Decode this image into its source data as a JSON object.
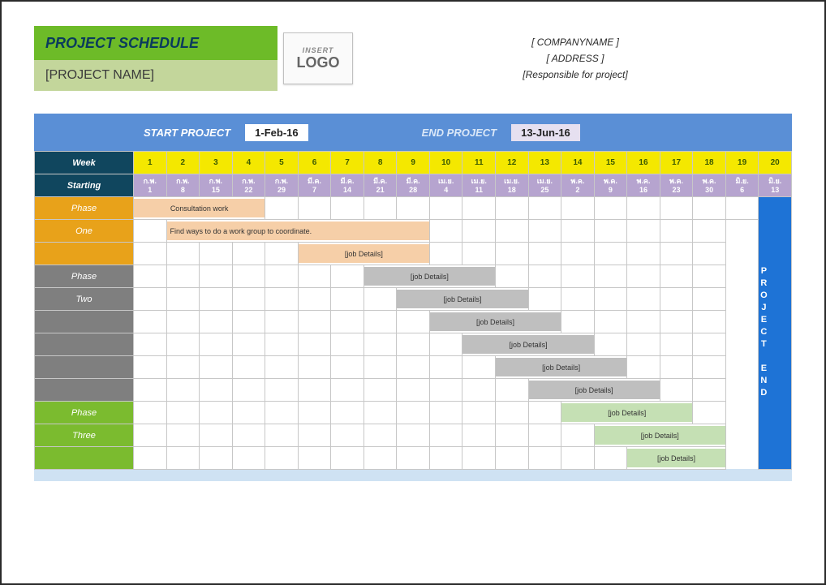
{
  "header": {
    "title": "PROJECT SCHEDULE",
    "project_name": "[PROJECT NAME]",
    "logo_insert": "INSERT",
    "logo_text": "LOGO",
    "company": "[ COMPANYNAME ]",
    "address": "[ ADDRESS ]",
    "responsible": "[Responsible for project]"
  },
  "band": {
    "start_label": "START PROJECT",
    "start_value": "1-Feb-16",
    "end_label": "END PROJECT",
    "end_value": "13-Jun-16"
  },
  "table": {
    "week_label": "Week",
    "starting_label": "Starting",
    "weeks": [
      "1",
      "2",
      "3",
      "4",
      "5",
      "6",
      "7",
      "8",
      "9",
      "10",
      "11",
      "12",
      "13",
      "14",
      "15",
      "16",
      "17",
      "18",
      "19",
      "20"
    ],
    "months": [
      {
        "m": "ก.พ.",
        "d": "1"
      },
      {
        "m": "ก.พ.",
        "d": "8"
      },
      {
        "m": "ก.พ.",
        "d": "15"
      },
      {
        "m": "ก.พ.",
        "d": "22"
      },
      {
        "m": "ก.พ.",
        "d": "29"
      },
      {
        "m": "มี.ค.",
        "d": "7"
      },
      {
        "m": "มี.ค.",
        "d": "14"
      },
      {
        "m": "มี.ค.",
        "d": "21"
      },
      {
        "m": "มี.ค.",
        "d": "28"
      },
      {
        "m": "เม.ย.",
        "d": "4"
      },
      {
        "m": "เม.ย.",
        "d": "11"
      },
      {
        "m": "เม.ย.",
        "d": "18"
      },
      {
        "m": "เม.ย.",
        "d": "25"
      },
      {
        "m": "พ.ค.",
        "d": "2"
      },
      {
        "m": "พ.ค.",
        "d": "9"
      },
      {
        "m": "พ.ค.",
        "d": "16"
      },
      {
        "m": "พ.ค.",
        "d": "23"
      },
      {
        "m": "พ.ค.",
        "d": "30"
      },
      {
        "m": "มิ.ย.",
        "d": "6"
      },
      {
        "m": "มิ.ย.",
        "d": "13"
      }
    ],
    "end_text": "PROJECT END",
    "phases": {
      "one": {
        "line1": "Phase",
        "line2": "One"
      },
      "two": {
        "line1": "Phase",
        "line2": "Two"
      },
      "three": {
        "line1": "Phase",
        "line2": "Three"
      }
    },
    "bars": {
      "consult": "Consultation work",
      "find": "Find ways to do a work group to coordinate.",
      "job": "[job Details]"
    }
  }
}
